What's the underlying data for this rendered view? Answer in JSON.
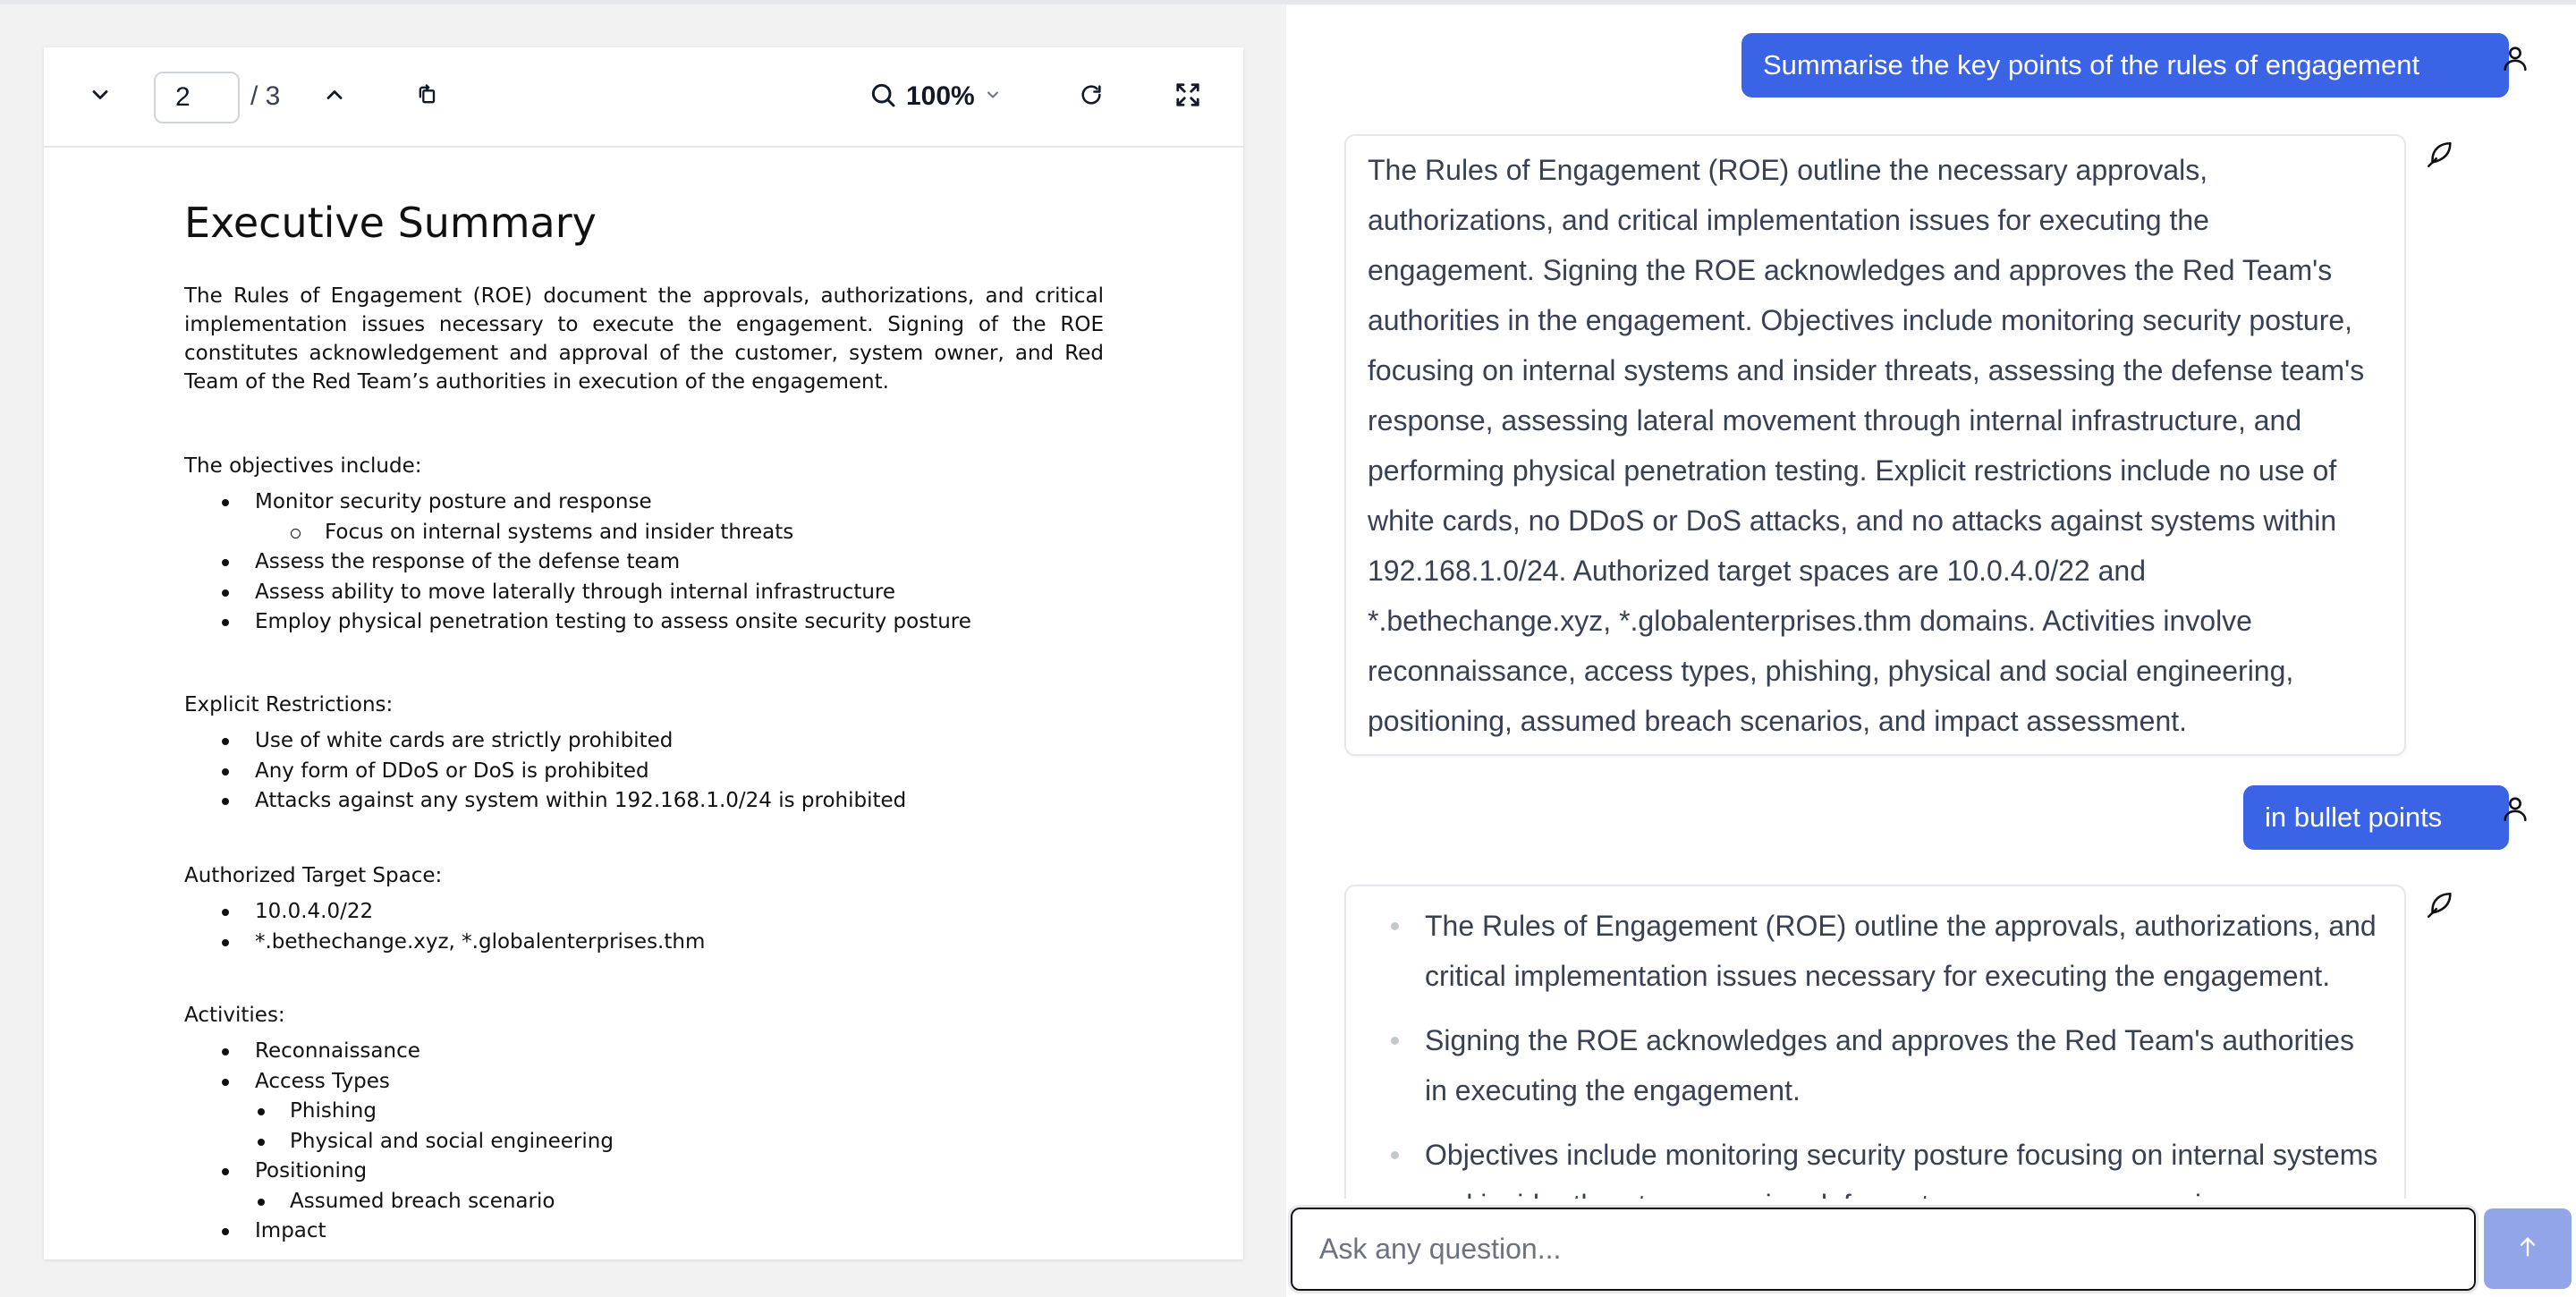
{
  "pdf_viewer": {
    "page_current": "2",
    "page_total": "/ 3",
    "zoom": "100%",
    "icons": {
      "prev": "chevron-down-icon",
      "next": "chevron-up-icon",
      "rotate": "rotate-icon",
      "search": "search-icon",
      "zoom_caret": "chevron-down-icon",
      "refresh": "refresh-icon",
      "fullscreen": "fullscreen-icon"
    },
    "document": {
      "title": "Executive Summary",
      "intro": "The Rules of Engagement (ROE) document the approvals, authorizations, and critical implementation issues necessary to execute the engagement.  Signing of the ROE constitutes acknowledgement and approval of the customer, system owner, and Red Team of the Red Team’s authorities in execution of the engagement.",
      "objectives_heading": "The objectives include:",
      "objectives": [
        {
          "text": "Monitor security posture and response",
          "style": "bullet"
        },
        {
          "text": "Focus on internal systems and insider threats",
          "style": "circle"
        },
        {
          "text": "Assess the response of the defense team",
          "style": "bullet"
        },
        {
          "text": "Assess ability to move laterally through internal infrastructure",
          "style": "bullet"
        },
        {
          "text": "Employ physical penetration testing to assess onsite security posture",
          "style": "bullet"
        }
      ],
      "restrictions_heading": "Explicit Restrictions:",
      "restrictions": [
        "Use of white cards are strictly prohibited",
        "Any form of DDoS or DoS is prohibited",
        "Attacks against any system within 192.168.1.0/24 is prohibited"
      ],
      "targets_heading": "Authorized Target Space:",
      "targets": [
        "10.0.4.0/22",
        "*.bethechange.xyz, *.globalenterprises.thm"
      ],
      "activities_heading": "Activities:",
      "activities": [
        {
          "text": "Reconnaissance",
          "style": "bullet"
        },
        {
          "text": "Access Types",
          "style": "bullet"
        },
        {
          "text": "Phishing",
          "style": "sub"
        },
        {
          "text": "Physical and social engineering",
          "style": "sub"
        },
        {
          "text": "Positioning",
          "style": "bullet"
        },
        {
          "text": "Assumed breach scenario",
          "style": "sub"
        },
        {
          "text": "Impact",
          "style": "bullet"
        }
      ]
    }
  },
  "chat": {
    "messages": [
      {
        "role": "user",
        "text": "Summarise the key points of the rules of engagement"
      },
      {
        "role": "assistant",
        "text": "The Rules of Engagement (ROE) outline the necessary approvals, authorizations, and critical implementation issues for executing the engagement. Signing the ROE acknowledges and approves the Red Team's authorities in the engagement. Objectives include monitoring security posture, focusing on internal systems and insider threats, assessing the defense team's response, assessing lateral movement through internal infrastructure, and performing physical penetration testing. Explicit restrictions include no use of white cards, no DDoS or DoS attacks, and no attacks against systems within 192.168.1.0/24. Authorized target spaces are 10.0.4.0/22 and *.bethechange.xyz, *.globalenterprises.thm domains. Activities involve reconnaissance, access types, phishing, physical and social engineering, positioning, assumed breach scenarios, and impact assessment."
      },
      {
        "role": "user",
        "text": "in bullet points"
      },
      {
        "role": "assistant",
        "bullets": [
          "The Rules of Engagement (ROE) outline the approvals, authorizations, and critical implementation issues necessary for executing the engagement.",
          "Signing the ROE acknowledges and approves the Red Team's authorities in executing the engagement.",
          "Objectives include monitoring security posture focusing on internal systems and insider threats, assessing defense team responses, moving"
        ]
      }
    ],
    "input_placeholder": "Ask any question...",
    "icons": {
      "user": "user-icon",
      "assistant": "feather-icon",
      "send": "arrow-up-icon"
    }
  }
}
